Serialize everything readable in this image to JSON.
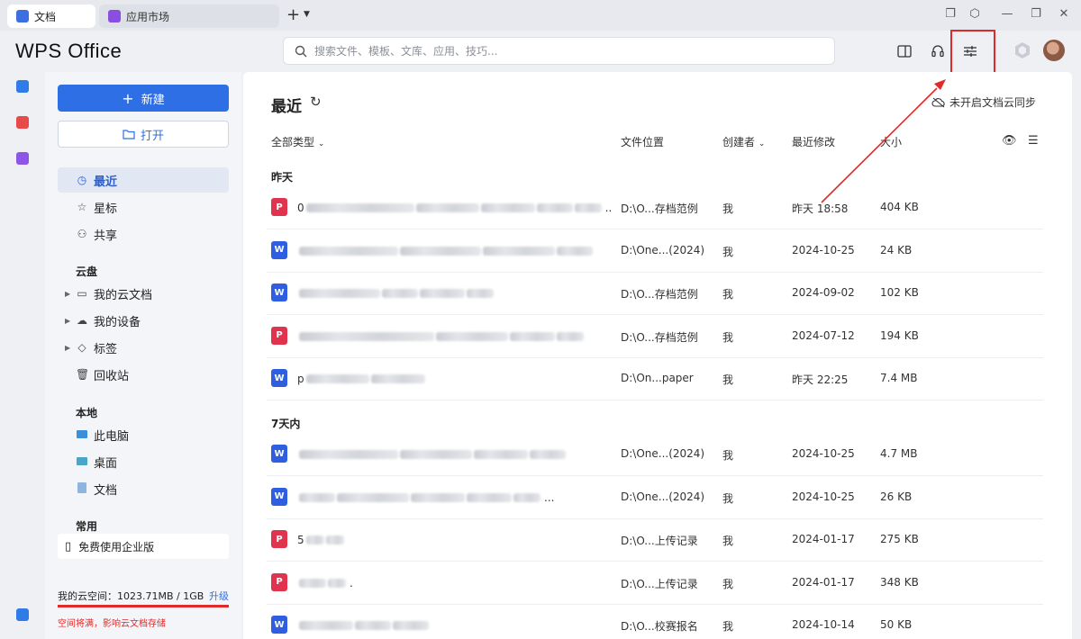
{
  "tabs": [
    {
      "label": "文档",
      "color": "#3c6fe0"
    },
    {
      "label": "应用市场",
      "color": "#8a4fe0"
    }
  ],
  "brand": "WPS Office",
  "search": {
    "placeholder": "搜索文件、模板、文库、应用、技巧..."
  },
  "sidebar": {
    "new_label": "新建",
    "open_label": "打开",
    "nav": [
      {
        "label": "最近",
        "icon": "clock-icon"
      },
      {
        "label": "星标",
        "icon": "star-icon"
      },
      {
        "label": "共享",
        "icon": "share-icon"
      }
    ],
    "cloud_title": "云盘",
    "cloud_items": [
      {
        "label": "我的云文档",
        "icon": "folder-icon"
      },
      {
        "label": "我的设备",
        "icon": "cloud-device-icon"
      },
      {
        "label": "标签",
        "icon": "tag-icon"
      },
      {
        "label": "回收站",
        "icon": "trash-icon"
      }
    ],
    "local_title": "本地",
    "local_items": [
      {
        "label": "此电脑",
        "icon": "computer-icon"
      },
      {
        "label": "桌面",
        "icon": "desktop-icon"
      },
      {
        "label": "文档",
        "icon": "document-icon"
      }
    ],
    "common_title": "常用",
    "enterprise_label": "免费使用企业版",
    "storage_text": "我的云空间：1023.71MB / 1GB",
    "upgrade_label": "升级",
    "storage_fraction": 1.0,
    "storage_warning": "空间将满，影响云文档存储"
  },
  "main": {
    "title": "最近",
    "sync_label": "未开启文档云同步",
    "columns": {
      "type": "全部类型",
      "location": "文件位置",
      "creator": "创建者",
      "modified": "最近修改",
      "size": "大小"
    },
    "groups": [
      {
        "title": "昨天",
        "rows": [
          {
            "type": "pdf",
            "name_prefix": "0",
            "name_suffix": "..",
            "location": "D:\\O...存档范例",
            "creator": "我",
            "modified": "昨天 18:58",
            "size": "404 KB"
          },
          {
            "type": "word",
            "name_prefix": "",
            "name_suffix": "",
            "location": "D:\\One...(2024)",
            "creator": "我",
            "modified": "2024-10-25",
            "size": "24 KB"
          },
          {
            "type": "word",
            "name_prefix": "",
            "name_suffix": "",
            "location": "D:\\O...存档范例",
            "creator": "我",
            "modified": "2024-09-02",
            "size": "102 KB"
          },
          {
            "type": "pdf",
            "name_prefix": "",
            "name_suffix": "",
            "location": "D:\\O...存档范例",
            "creator": "我",
            "modified": "2024-07-12",
            "size": "194 KB"
          },
          {
            "type": "word",
            "name_prefix": "p",
            "name_suffix": "",
            "location": "D:\\On...paper",
            "creator": "我",
            "modified": "昨天 22:25",
            "size": "7.4 MB"
          }
        ]
      },
      {
        "title": "7天内",
        "rows": [
          {
            "type": "word",
            "name_prefix": "",
            "name_suffix": "",
            "location": "D:\\One...(2024)",
            "creator": "我",
            "modified": "2024-10-25",
            "size": "4.7 MB"
          },
          {
            "type": "word",
            "name_prefix": "",
            "name_suffix": "...",
            "location": "D:\\One...(2024)",
            "creator": "我",
            "modified": "2024-10-25",
            "size": "26 KB"
          },
          {
            "type": "pdf",
            "name_prefix": "5",
            "name_suffix": "",
            "location": "D:\\O...上传记录",
            "creator": "我",
            "modified": "2024-01-17",
            "size": "275 KB"
          },
          {
            "type": "pdf",
            "name_prefix": "",
            "name_suffix": ".",
            "location": "D:\\O...上传记录",
            "creator": "我",
            "modified": "2024-01-17",
            "size": "348 KB"
          },
          {
            "type": "word",
            "name_prefix": "",
            "name_suffix": "",
            "location": "D:\\O...校赛报名",
            "creator": "我",
            "modified": "2024-10-14",
            "size": "50 KB"
          }
        ]
      }
    ]
  },
  "colors": {
    "accent": "#2f6fe6",
    "highlight": "#e02a2a",
    "word": "#2f5fe0",
    "pdf": "#e0334d"
  }
}
